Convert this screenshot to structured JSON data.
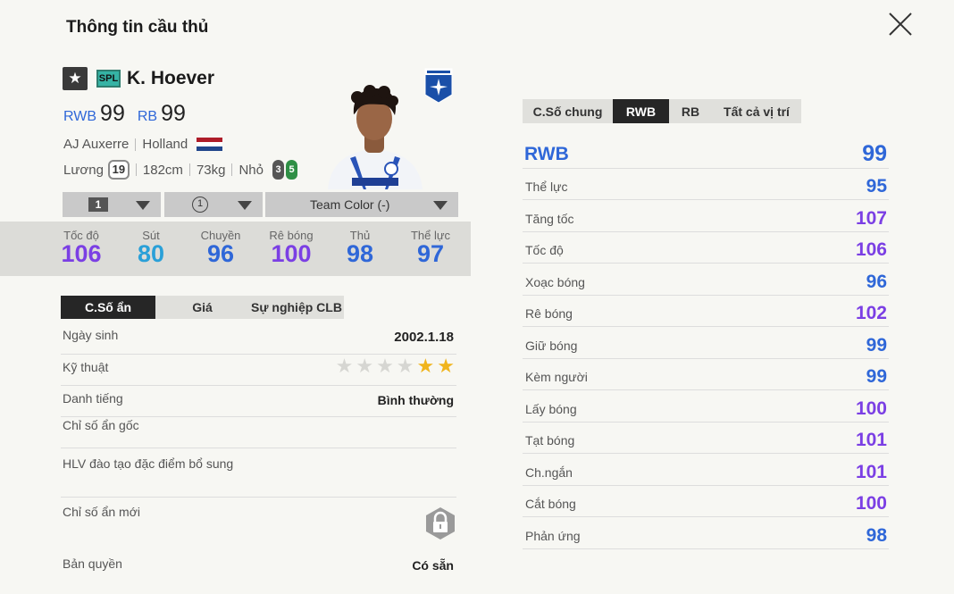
{
  "header": {
    "title": "Thông tin cầu thủ"
  },
  "player": {
    "name": "K. Hoever",
    "season": "SPL",
    "positions": [
      {
        "pos": "RWB",
        "ovr": "99"
      },
      {
        "pos": "RB",
        "ovr": "99"
      }
    ],
    "club": "AJ Auxerre",
    "nation": "Holland",
    "salary_label": "Lương",
    "salary": "19",
    "height": "182cm",
    "weight": "73kg",
    "body_type": "Nhỏ",
    "weak_foot": "3",
    "strong_foot": "5"
  },
  "selectors": {
    "level": "1",
    "chem": "1",
    "team_color": "Team Color (-)"
  },
  "stats": [
    {
      "label": "Tốc độ",
      "value": "106",
      "color": "#7b3fe4"
    },
    {
      "label": "Sút",
      "value": "80",
      "color": "#2aa0d8"
    },
    {
      "label": "Chuyền",
      "value": "96",
      "color": "#2f67d8"
    },
    {
      "label": "Rê bóng",
      "value": "100",
      "color": "#7b3fe4"
    },
    {
      "label": "Thủ",
      "value": "98",
      "color": "#2f67d8"
    },
    {
      "label": "Thể lực",
      "value": "97",
      "color": "#2f67d8"
    }
  ],
  "left_tabs": [
    "C.Số ẩn",
    "Giá",
    "Sự nghiệp CLB"
  ],
  "hidden": {
    "birth_label": "Ngày sinh",
    "birth": "2002.1.18",
    "skill_label": "Kỹ thuật",
    "skill_stars": 2,
    "rep_label": "Danh tiếng",
    "rep": "Bình thường",
    "orig_label": "Chỉ số ẩn gốc",
    "coach_label": "HLV đào tạo đặc điểm bổ sung",
    "new_label": "Chỉ số ẩn mới",
    "license_label": "Bản quyền",
    "license": "Có sẵn"
  },
  "right_tabs": [
    "C.Số chung",
    "RWB",
    "RB",
    "Tất cả vị trí"
  ],
  "position_stats": {
    "head": {
      "label": "RWB",
      "value": "99"
    },
    "rows": [
      {
        "label": "Thể lực",
        "value": "95",
        "color": "#2f67d8"
      },
      {
        "label": "Tăng tốc",
        "value": "107",
        "color": "#7b3fe4"
      },
      {
        "label": "Tốc độ",
        "value": "106",
        "color": "#7b3fe4"
      },
      {
        "label": "Xoạc bóng",
        "value": "96",
        "color": "#2f67d8"
      },
      {
        "label": "Rê bóng",
        "value": "102",
        "color": "#7b3fe4"
      },
      {
        "label": "Giữ bóng",
        "value": "99",
        "color": "#2f67d8"
      },
      {
        "label": "Kèm người",
        "value": "99",
        "color": "#2f67d8"
      },
      {
        "label": "Lấy bóng",
        "value": "100",
        "color": "#7b3fe4"
      },
      {
        "label": "Tạt bóng",
        "value": "101",
        "color": "#7b3fe4"
      },
      {
        "label": "Ch.ngắn",
        "value": "101",
        "color": "#7b3fe4"
      },
      {
        "label": "Cắt bóng",
        "value": "100",
        "color": "#7b3fe4"
      },
      {
        "label": "Phản ứng",
        "value": "98",
        "color": "#2f67d8"
      }
    ]
  }
}
